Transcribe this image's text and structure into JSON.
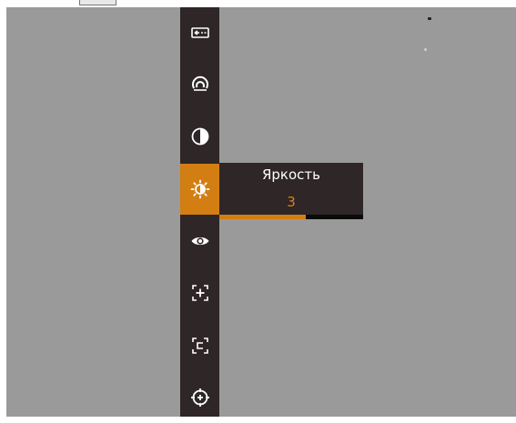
{
  "colors": {
    "viewport_bg": "#9a9a9a",
    "menu_bg": "#2e2627",
    "accent": "#d37e12",
    "value_text": "#d9801a",
    "icon": "#ffffff"
  },
  "sidebar": {
    "items": [
      {
        "id": "battery",
        "icon": "battery-icon",
        "active": false
      },
      {
        "id": "scene",
        "icon": "scene-mode-icon",
        "active": false
      },
      {
        "id": "contrast",
        "icon": "contrast-icon",
        "active": false
      },
      {
        "id": "brightness",
        "icon": "brightness-icon",
        "active": true
      },
      {
        "id": "eye",
        "icon": "eye-icon",
        "active": false
      },
      {
        "id": "zoom",
        "icon": "zoom-frame-icon",
        "active": false
      },
      {
        "id": "calibrate",
        "icon": "calibration-frame-icon",
        "active": false
      },
      {
        "id": "crosshair",
        "icon": "crosshair-icon",
        "active": false
      }
    ]
  },
  "popup": {
    "title": "Яркость",
    "value": "3",
    "progress_fraction": 0.6
  }
}
